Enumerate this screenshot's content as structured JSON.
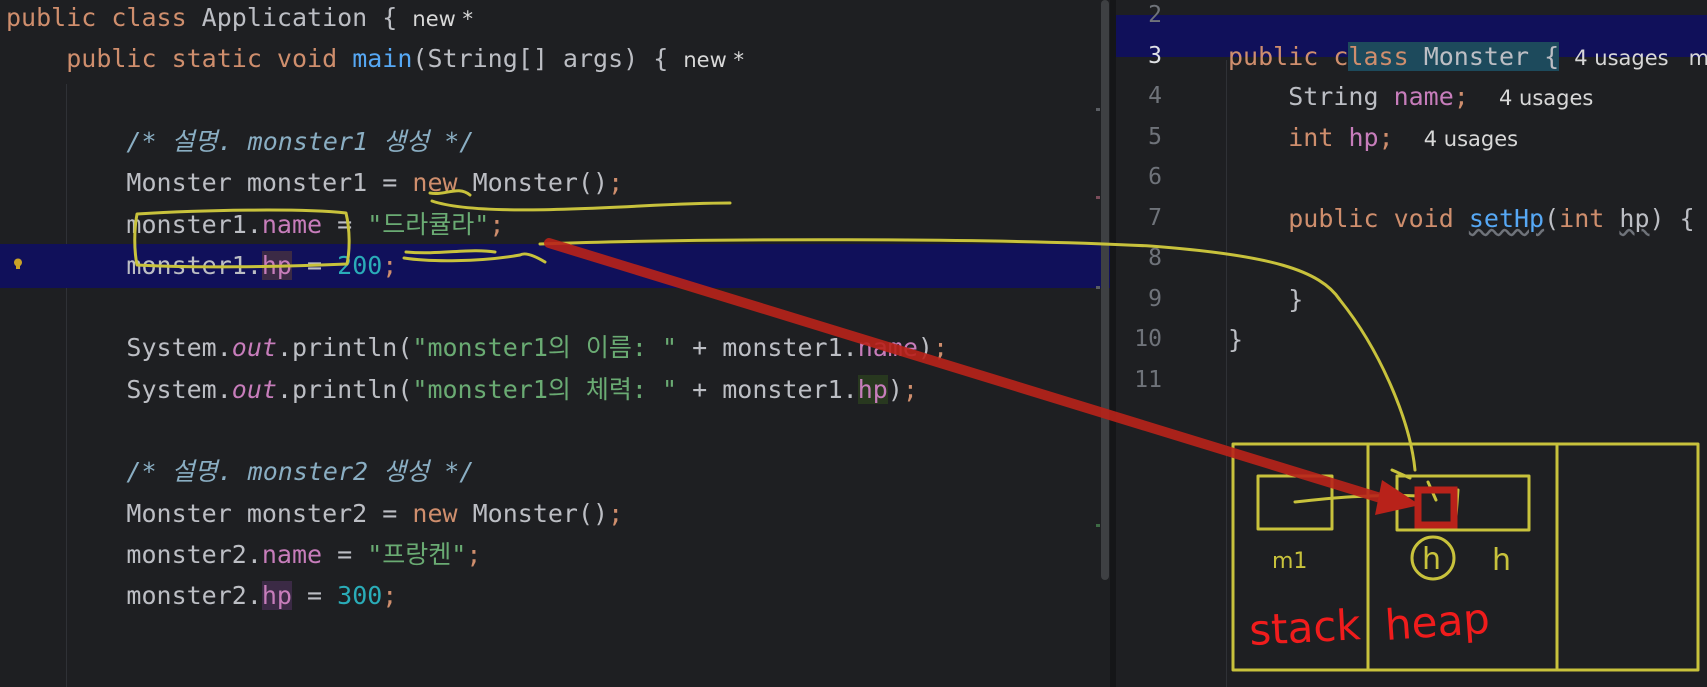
{
  "left_editor": {
    "lines": [
      {
        "parts": [
          [
            "kw",
            "public class "
          ],
          [
            "typ",
            "Application"
          ],
          [
            "plain",
            " { "
          ],
          [
            "hint",
            "new *"
          ]
        ]
      },
      {
        "parts": [
          [
            "plain",
            "    "
          ],
          [
            "kw",
            "public static void "
          ],
          [
            "fn",
            "main"
          ],
          [
            "plain",
            "(String[] args) { "
          ],
          [
            "hint",
            "new *"
          ]
        ]
      },
      {
        "parts": []
      },
      {
        "parts": [
          [
            "plain",
            "        "
          ],
          [
            "cmt",
            "/* 설명. monster1 생성 */"
          ]
        ]
      },
      {
        "parts": [
          [
            "plain",
            "        Monster monster1 = "
          ],
          [
            "kw",
            "new "
          ],
          [
            "plain",
            "Monster()"
          ],
          [
            "kw",
            ";"
          ]
        ]
      },
      {
        "parts": [
          [
            "plain",
            "        monster1."
          ],
          [
            "field",
            "name"
          ],
          [
            "plain",
            " = "
          ],
          [
            "str",
            "\"드라큘라\""
          ],
          [
            "kw",
            ";"
          ]
        ]
      },
      {
        "parts": [
          [
            "plain",
            "        monster1."
          ],
          [
            "field fieldhl",
            "hp"
          ],
          [
            "plain",
            " = "
          ],
          [
            "num",
            "200"
          ],
          [
            "kw",
            ";"
          ]
        ]
      },
      {
        "parts": []
      },
      {
        "parts": [
          [
            "plain",
            "        System."
          ],
          [
            "out",
            "out"
          ],
          [
            "plain",
            ".println("
          ],
          [
            "str",
            "\"monster1의 이름: \""
          ],
          [
            "plain",
            " + monster1."
          ],
          [
            "field",
            "name"
          ],
          [
            "plain",
            ")"
          ],
          [
            "kw",
            ";"
          ]
        ]
      },
      {
        "parts": [
          [
            "plain",
            "        System."
          ],
          [
            "out",
            "out"
          ],
          [
            "plain",
            ".println("
          ],
          [
            "str",
            "\"monster1의 체력: \""
          ],
          [
            "plain",
            " + monster1."
          ],
          [
            "field fieldhl2",
            "hp"
          ],
          [
            "plain",
            ")"
          ],
          [
            "kw",
            ";"
          ]
        ]
      },
      {
        "parts": []
      },
      {
        "parts": [
          [
            "plain",
            "        "
          ],
          [
            "cmt",
            "/* 설명. monster2 생성 */"
          ]
        ]
      },
      {
        "parts": [
          [
            "plain",
            "        Monster monster2 = "
          ],
          [
            "kw",
            "new "
          ],
          [
            "plain",
            "Monster()"
          ],
          [
            "kw",
            ";"
          ]
        ]
      },
      {
        "parts": [
          [
            "plain",
            "        monster2."
          ],
          [
            "field",
            "name"
          ],
          [
            "plain",
            " = "
          ],
          [
            "str",
            "\"프랑켄\""
          ],
          [
            "kw",
            ";"
          ]
        ]
      },
      {
        "parts": [
          [
            "plain",
            "        monster2."
          ],
          [
            "field fieldhl",
            "hp"
          ],
          [
            "plain",
            " = "
          ],
          [
            "num",
            "300"
          ],
          [
            "kw",
            ";"
          ]
        ]
      }
    ],
    "current_line_index": 6
  },
  "right_editor": {
    "line_numbers": [
      "2",
      "3",
      "4",
      "5",
      "6",
      "7",
      "8",
      "9",
      "10",
      "11"
    ],
    "current_line_number": "3",
    "lines": [
      {
        "parts": []
      },
      {
        "parts": [
          [
            "kw",
            "public c"
          ],
          [
            "kw classhl",
            "lass "
          ],
          [
            "plain classhl",
            "Monster {"
          ],
          [
            "plain",
            " "
          ],
          [
            "hint",
            "4 usages   m"
          ]
        ]
      },
      {
        "parts": [
          [
            "plain",
            "    String "
          ],
          [
            "field",
            "name"
          ],
          [
            "kw",
            ";"
          ],
          [
            "plain",
            "  "
          ],
          [
            "hint",
            "4 usages"
          ]
        ]
      },
      {
        "parts": [
          [
            "plain",
            "    "
          ],
          [
            "kw",
            "int "
          ],
          [
            "field",
            "hp"
          ],
          [
            "kw",
            ";"
          ],
          [
            "plain",
            "  "
          ],
          [
            "hint",
            "4 usages"
          ]
        ]
      },
      {
        "parts": []
      },
      {
        "parts": [
          [
            "plain",
            "    "
          ],
          [
            "kw",
            "public void "
          ],
          [
            "fn ulw",
            "setHp"
          ],
          [
            "plain",
            "("
          ],
          [
            "kw",
            "int "
          ],
          [
            "plain ulw",
            "hp"
          ],
          [
            "plain",
            ") {"
          ]
        ]
      },
      {
        "parts": []
      },
      {
        "parts": [
          [
            "plain",
            "    }"
          ]
        ]
      },
      {
        "parts": [
          [
            "plain",
            "}"
          ]
        ]
      },
      {
        "parts": []
      }
    ]
  },
  "annotations": {
    "stack_label": "stack",
    "heap_label": "heap",
    "m1_label": "m1",
    "h_label": "h",
    "h_circled_label": "h",
    "pen_color": "#c8c23c",
    "arrow_color": "#b8221a",
    "red_text_color": "#f01c1c"
  }
}
